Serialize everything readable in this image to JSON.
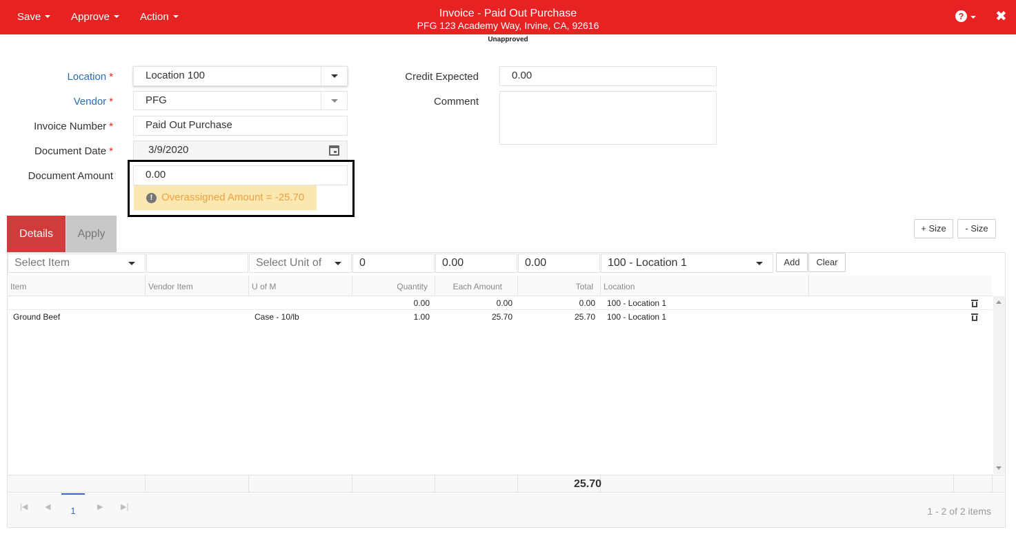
{
  "topbar": {
    "menus": {
      "save": "Save",
      "approve": "Approve",
      "action": "Action"
    },
    "title": "Invoice - Paid Out Purchase",
    "subtitle": "PFG 123 Academy Way, Irvine, CA, 92616",
    "help_icon": "?",
    "close_icon": "✖",
    "brand_color": "#e62222"
  },
  "status": "Unapproved",
  "form": {
    "location": {
      "label": "Location",
      "value": "Location 100"
    },
    "vendor": {
      "label": "Vendor",
      "value": "PFG"
    },
    "invoice_number": {
      "label": "Invoice Number",
      "value": "Paid Out Purchase"
    },
    "document_date": {
      "label": "Document Date",
      "value": "3/9/2020"
    },
    "document_amount": {
      "label": "Document Amount",
      "value": "0.00"
    },
    "warning": "Overassigned Amount = -25.70",
    "credit_expected": {
      "label": "Credit Expected",
      "value": "0.00"
    },
    "comment": {
      "label": "Comment",
      "value": ""
    },
    "required_mark": "*"
  },
  "tabs": {
    "details": "Details",
    "apply": "Apply"
  },
  "size_buttons": {
    "plus": "+ Size",
    "minus": "- Size"
  },
  "entry": {
    "item_placeholder": "Select Item",
    "vendor_item": "",
    "uom_placeholder": "Select Unit of M",
    "quantity": "0",
    "each_amount": "0.00",
    "total": "0.00",
    "location": "100 - Location 1",
    "add": "Add",
    "clear": "Clear"
  },
  "grid": {
    "headers": [
      "Item",
      "Vendor Item",
      "U of M",
      "Quantity",
      "Each Amount",
      "Total",
      "Location"
    ],
    "rows": [
      {
        "item": "",
        "vendor_item": "",
        "uom": "",
        "quantity": "0.00",
        "each_amount": "0.00",
        "total": "0.00",
        "location": "100 - Location 1"
      },
      {
        "item": "Ground Beef",
        "vendor_item": "",
        "uom": "Case - 10/lb",
        "quantity": "1.00",
        "each_amount": "25.70",
        "total": "25.70",
        "location": "100 - Location 1"
      }
    ],
    "total_sum": "25.70"
  },
  "pager": {
    "page": "1",
    "info": "1 - 2 of 2 items"
  }
}
